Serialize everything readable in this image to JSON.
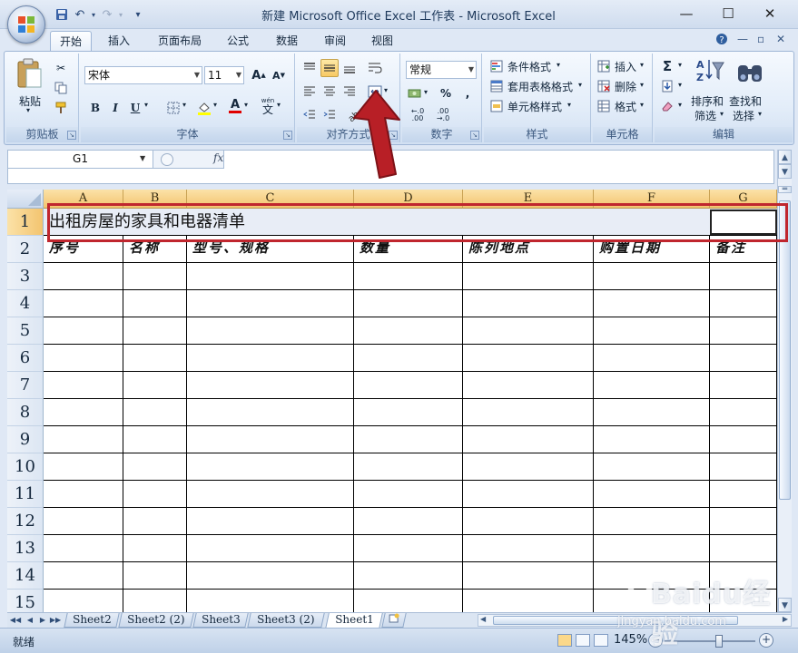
{
  "window": {
    "title": "新建 Microsoft Office Excel 工作表 - Microsoft Excel",
    "minimize": "—",
    "maximize": "☐",
    "close": "✕"
  },
  "qat": {
    "customize": "▾"
  },
  "tabs": [
    {
      "label": "开始",
      "active": true
    },
    {
      "label": "插入"
    },
    {
      "label": "页面布局"
    },
    {
      "label": "公式"
    },
    {
      "label": "数据"
    },
    {
      "label": "审阅"
    },
    {
      "label": "视图"
    }
  ],
  "ribbon": {
    "clipboard": {
      "label": "剪贴板",
      "paste": "粘贴"
    },
    "font": {
      "label": "字体",
      "name": "宋体",
      "size": "11",
      "bold": "B",
      "italic": "I",
      "underline": "U",
      "grow": "A",
      "shrink": "A",
      "font_color_letter": "A",
      "phonetic": "wén"
    },
    "alignment": {
      "label": "对齐方式"
    },
    "number": {
      "label": "数字",
      "format": "常规",
      "percent": "%",
      "comma": ","
    },
    "styles": {
      "label": "样式",
      "conditional": "条件格式",
      "table": "套用表格格式",
      "cell": "单元格样式"
    },
    "cells": {
      "label": "单元格",
      "insert": "插入",
      "delete": "删除",
      "format": "格式"
    },
    "editing": {
      "label": "编辑",
      "sort": "排序和",
      "sort2": "筛选",
      "find": "查找和",
      "find2": "选择",
      "sum": "Σ"
    }
  },
  "formula_bar": {
    "name_box": "G1",
    "fx": "fx",
    "value": ""
  },
  "columns": [
    "A",
    "B",
    "C",
    "D",
    "E",
    "F",
    "G"
  ],
  "rows": [
    "1",
    "2",
    "3",
    "4",
    "5",
    "6",
    "7",
    "8",
    "9",
    "10",
    "11",
    "12",
    "13",
    "14",
    "15"
  ],
  "sheet": {
    "title": "出租房屋的家具和电器清单",
    "headers": [
      "序号",
      "名称",
      "型号、规格",
      "数量",
      "陈列地点",
      "购置日期",
      "备注"
    ]
  },
  "sheet_tabs": [
    {
      "label": "Sheet2"
    },
    {
      "label": "Sheet2 (2)"
    },
    {
      "label": "Sheet3"
    },
    {
      "label": "Sheet3 (2)"
    },
    {
      "label": "Sheet1",
      "active": true
    }
  ],
  "status": {
    "text": "就绪",
    "zoom": "145%",
    "zoom_minus": "−",
    "zoom_plus": "+"
  },
  "watermark": {
    "text": "Baidu经验",
    "url": "jingyan.baidu.com"
  },
  "colors": {
    "accent": "#c0262e",
    "header_selected": "#f3c46f",
    "ribbon_bg": "#dfe8f5"
  }
}
